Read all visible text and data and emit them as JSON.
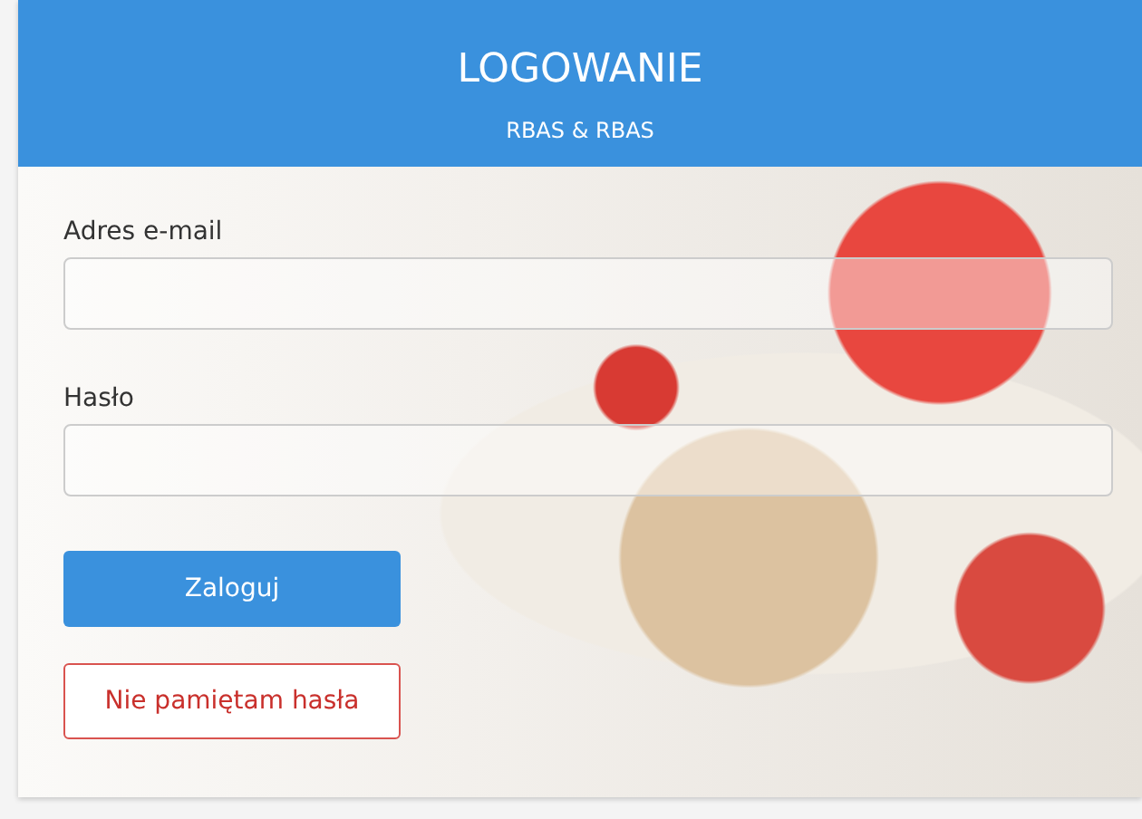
{
  "header": {
    "title": "LOGOWANIE",
    "subtitle": "RBAS & RBAS"
  },
  "fields": [
    {
      "label": "Adres e-mail"
    },
    {
      "label": "Hasło"
    }
  ],
  "buttons": [
    {
      "label": "Zaloguj",
      "kind": "primary"
    },
    {
      "label": "Nie pamiętam hasła",
      "kind": "outline"
    }
  ]
}
